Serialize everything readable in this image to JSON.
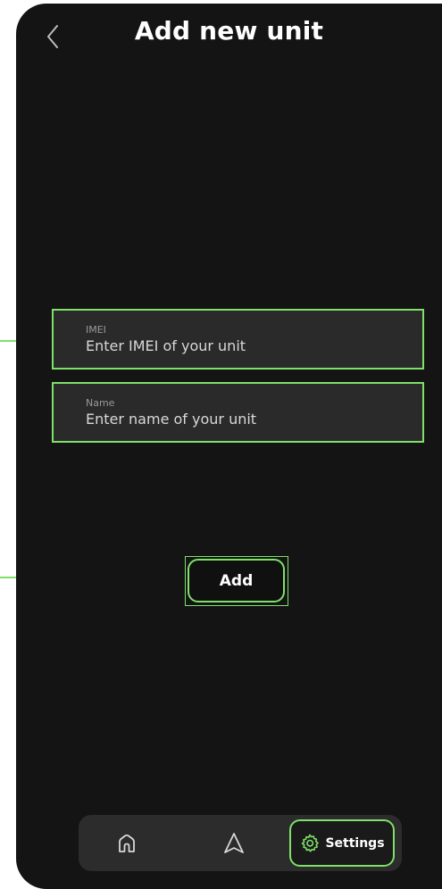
{
  "header": {
    "title": "Add new unit"
  },
  "form": {
    "imei": {
      "label": "IMEI",
      "placeholder": "Enter IMEI of your unit",
      "value": ""
    },
    "name": {
      "label": "Name",
      "placeholder": "Enter name of your unit",
      "value": ""
    },
    "submit_label": "Add"
  },
  "nav": {
    "items": [
      {
        "icon": "home-icon",
        "label": ""
      },
      {
        "icon": "navigation-arrow-icon",
        "label": ""
      },
      {
        "icon": "gear-icon",
        "label": "Settings",
        "active": true
      }
    ]
  },
  "colors": {
    "background": "#141414",
    "field_bg": "#2a2a2a",
    "accent": "#7fe06a",
    "nav_bg": "#2c2c2c"
  }
}
